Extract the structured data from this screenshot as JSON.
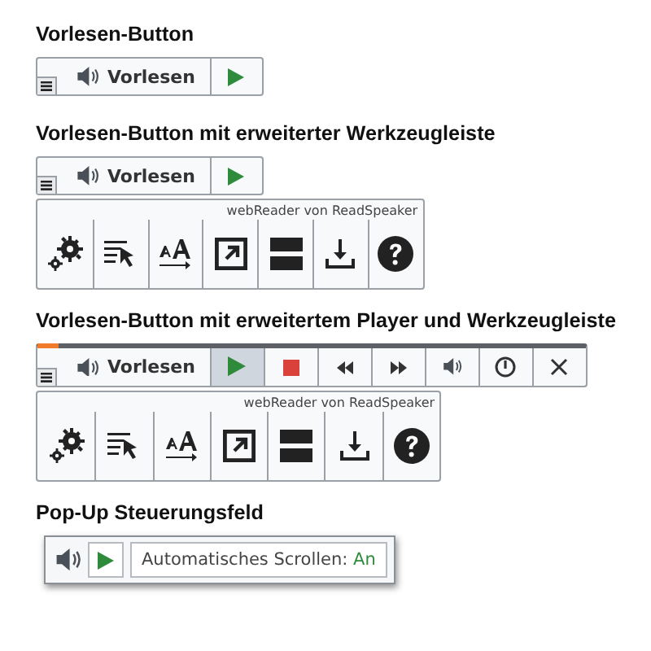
{
  "sections": [
    {
      "kind": "button",
      "title": "Vorlesen-Button",
      "button_label": "Vorlesen"
    },
    {
      "kind": "button_toolbar",
      "title": "Vorlesen-Button mit erweiterter Werkzeugleiste",
      "button_label": "Vorlesen",
      "toolbar_caption": "webReader von ReadSpeaker"
    },
    {
      "kind": "player_toolbar",
      "title": "Vorlesen-Button mit erweitertem Player und Werkzeugleiste",
      "button_label": "Vorlesen",
      "progress": {
        "level": 0.04
      },
      "controls": [
        {
          "kind": "play",
          "selected": true
        },
        {
          "kind": "stop",
          "selected": false
        },
        {
          "kind": "rewind",
          "selected": false
        },
        {
          "kind": "forward",
          "selected": false
        },
        {
          "kind": "volume",
          "selected": false
        },
        {
          "kind": "speed",
          "selected": false
        },
        {
          "kind": "close",
          "selected": false
        }
      ],
      "toolbar_caption": "webReader von ReadSpeaker"
    },
    {
      "kind": "popup",
      "title": "Pop-Up Steuerungsfeld",
      "scroll_label": "Automatisches Scrollen:",
      "scroll_value": "An",
      "scroll_on": true
    }
  ]
}
